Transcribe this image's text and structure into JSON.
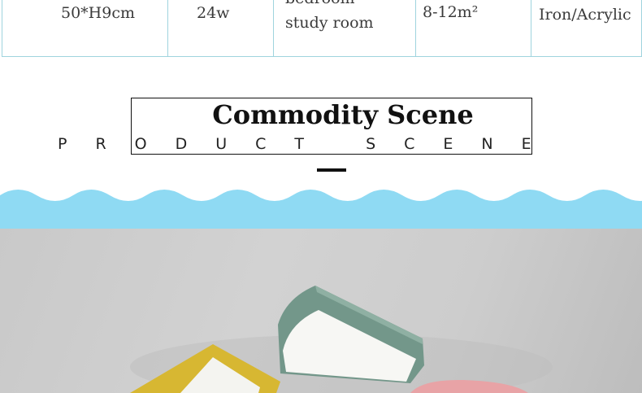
{
  "spec_row": {
    "size": "50*H9cm",
    "power": "24w",
    "room_line1": "bedroom",
    "room_line2": "study room",
    "area": "8-12m²",
    "material": "Iron/Acrylic"
  },
  "section": {
    "title": "Commodity Scene",
    "subtitle": "PRODUCT SCENE"
  },
  "colors": {
    "wave": "#8fdaf3",
    "border": "#9fd4de",
    "lamp_yellow": "#d7b732",
    "lamp_green": "#73978a",
    "lamp_pink": "#e8a3a6"
  }
}
